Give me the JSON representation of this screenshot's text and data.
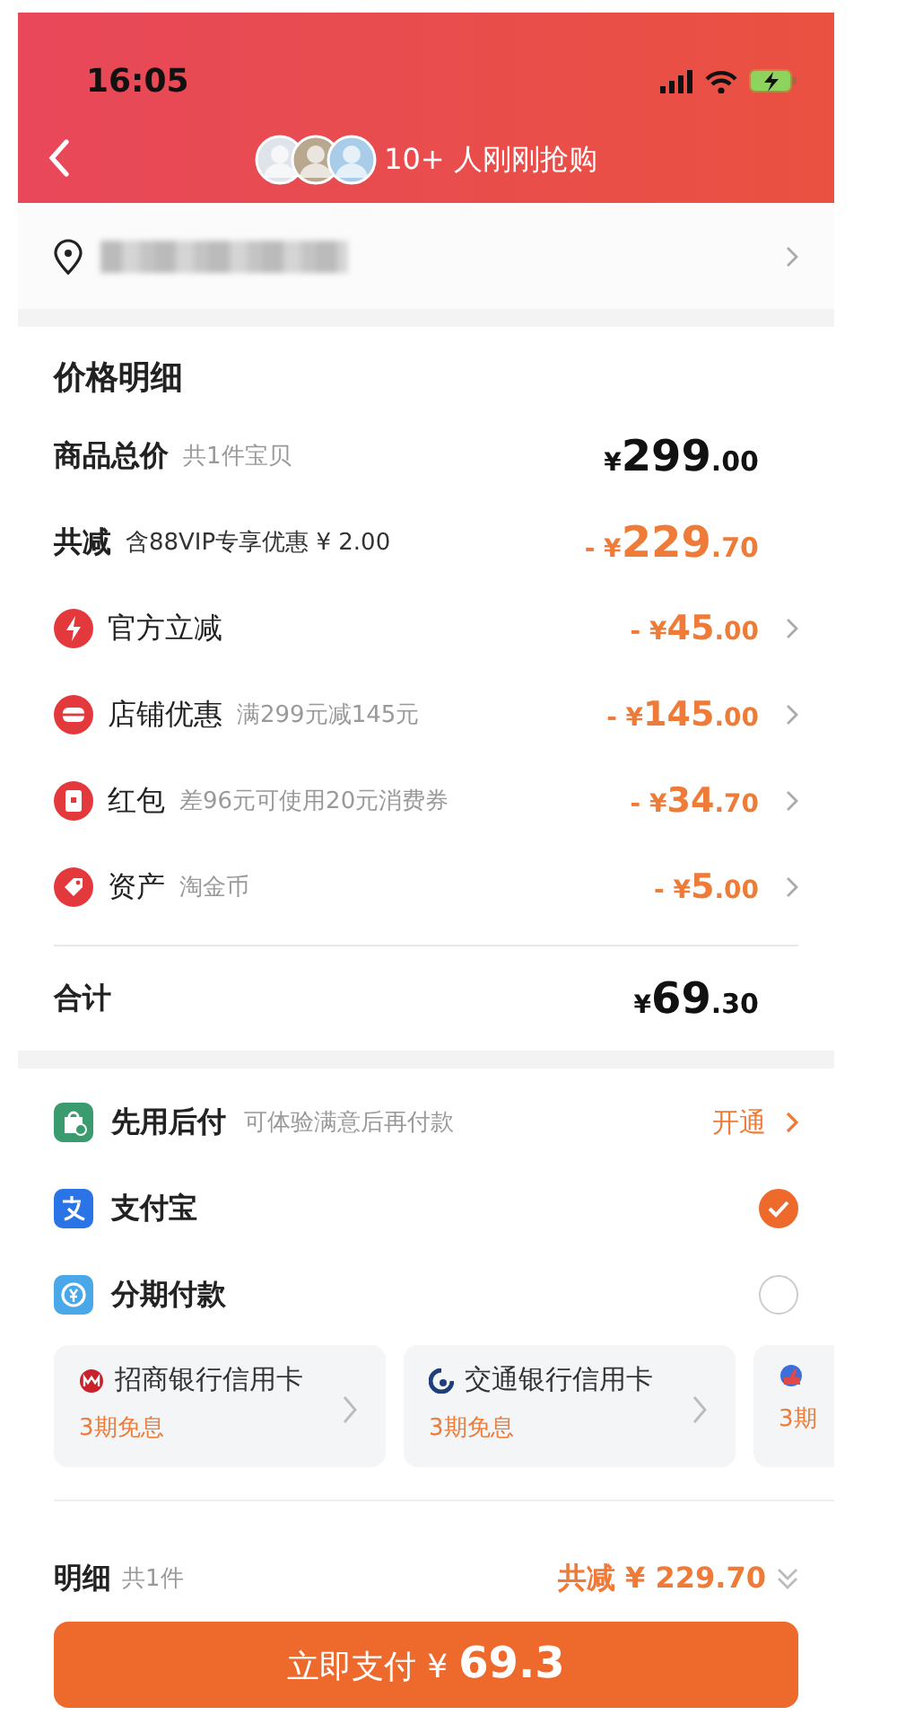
{
  "status_bar": {
    "time": "16:05"
  },
  "nav": {
    "title": "10+ 人刚刚抢购"
  },
  "price_detail": {
    "title": "价格明细",
    "rows": [
      {
        "kind": "total",
        "label": "商品总价",
        "hint": "共1件宝贝",
        "amount": {
          "prefix": "¥",
          "whole": "299",
          "fraction": ".00"
        }
      },
      {
        "kind": "discount",
        "label": "共减",
        "hint": "含88VIP专享优惠 ¥ 2.00",
        "amount": {
          "prefix": "- ¥",
          "whole": "229",
          "fraction": ".70"
        }
      },
      {
        "kind": "item",
        "label": "官方立减",
        "amount": {
          "prefix": "- ¥",
          "whole": "45",
          "fraction": ".00"
        }
      },
      {
        "kind": "item",
        "label": "店铺优惠",
        "hint": "满299元减145元",
        "amount": {
          "prefix": "- ¥",
          "whole": "145",
          "fraction": ".00"
        }
      },
      {
        "kind": "item",
        "label": "红包",
        "hint": "差96元可使用20元消费券",
        "amount": {
          "prefix": "- ¥",
          "whole": "34",
          "fraction": ".70"
        }
      },
      {
        "kind": "item",
        "label": "资产",
        "hint": "淘金币",
        "amount": {
          "prefix": "- ¥",
          "whole": "5",
          "fraction": ".00"
        }
      },
      {
        "kind": "sum",
        "label": "合计",
        "amount": {
          "prefix": "¥",
          "whole": "69",
          "fraction": ".30"
        }
      }
    ]
  },
  "payment": {
    "methods": [
      {
        "kind": "action",
        "label": "先用后付",
        "hint": "可体验满意后再付款",
        "action": "开通"
      },
      {
        "kind": "radio",
        "label": "支付宝",
        "selected": true
      },
      {
        "kind": "radio",
        "label": "分期付款",
        "selected": false
      }
    ],
    "cards": [
      {
        "name": "招商银行信用卡",
        "offer": "3期免息"
      },
      {
        "name": "交通银行信用卡",
        "offer": "3期免息"
      },
      {
        "offer": "3期"
      }
    ]
  },
  "footer": {
    "label": "明细",
    "count": "共1件",
    "discount": "共减 ¥ 229.70",
    "button": {
      "label": "立即支付",
      "prefix": "¥",
      "price": "69.3"
    }
  }
}
